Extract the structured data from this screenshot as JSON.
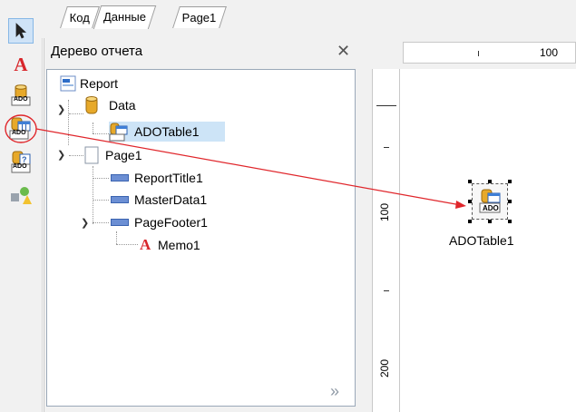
{
  "tabs": [
    {
      "label": "Код"
    },
    {
      "label": "Данные"
    },
    {
      "label": "Page1"
    }
  ],
  "tree_panel": {
    "title": "Дерево отчета",
    "nodes": [
      {
        "label": "Report"
      },
      {
        "label": "Data"
      },
      {
        "label": "ADOTable1"
      },
      {
        "label": "Page1"
      },
      {
        "label": "ReportTitle1"
      },
      {
        "label": "MasterData1"
      },
      {
        "label": "PageFooter1"
      },
      {
        "label": "Memo1"
      }
    ],
    "expand_label": "»"
  },
  "ruler": {
    "h_label": "100",
    "v_labels": [
      "100",
      "200"
    ]
  },
  "canvas": {
    "component_label": "ADOTable1",
    "icon_text": "ADO"
  },
  "toolbar_icons": {
    "text_glyph": "A",
    "ado_text": "ADO"
  },
  "colors": {
    "accent_red": "#e0262b",
    "selection_bg": "#cde4f7"
  }
}
